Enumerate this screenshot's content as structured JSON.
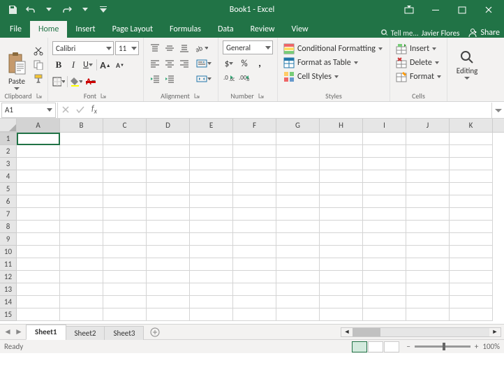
{
  "title": "Book1 - Excel",
  "user": "Javier Flores",
  "share": "Share",
  "tellme": "Tell me...",
  "tabs": {
    "file": "File",
    "home": "Home",
    "insert": "Insert",
    "pagelayout": "Page Layout",
    "formulas": "Formulas",
    "data": "Data",
    "review": "Review",
    "view": "View"
  },
  "ribbon": {
    "clipboard": {
      "paste": "Paste",
      "label": "Clipboard"
    },
    "font": {
      "name": "Calibri",
      "size": "11",
      "b": "B",
      "i": "I",
      "u": "U",
      "label": "Font"
    },
    "alignment": {
      "label": "Alignment"
    },
    "number": {
      "format": "General",
      "label": "Number"
    },
    "styles": {
      "cond": "Conditional Formatting",
      "table": "Format as Table",
      "cell": "Cell Styles",
      "label": "Styles"
    },
    "cells": {
      "insert": "Insert",
      "delete": "Delete",
      "format": "Format",
      "label": "Cells"
    },
    "editing": {
      "label": "Editing"
    }
  },
  "namebox": "A1",
  "columns": [
    "A",
    "B",
    "C",
    "D",
    "E",
    "F",
    "G",
    "H",
    "I",
    "J",
    "K"
  ],
  "rows": [
    "1",
    "2",
    "3",
    "4",
    "5",
    "6",
    "7",
    "8",
    "9",
    "10",
    "11",
    "12",
    "13",
    "14",
    "15"
  ],
  "sheets": {
    "s1": "Sheet1",
    "s2": "Sheet2",
    "s3": "Sheet3"
  },
  "status": {
    "ready": "Ready",
    "zoom": "100%"
  }
}
